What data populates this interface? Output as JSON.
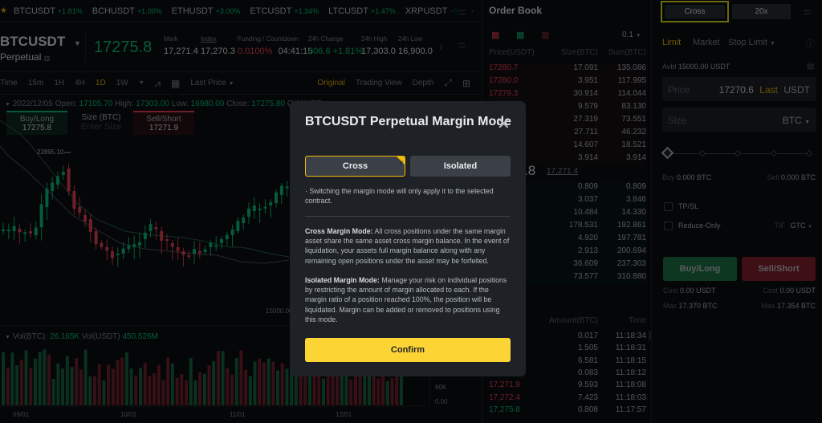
{
  "ticker": {
    "items": [
      {
        "symbol": "BTCUSDT",
        "change": "+1.81%"
      },
      {
        "symbol": "BCHUSDT",
        "change": "+1.00%"
      },
      {
        "symbol": "ETHUSDT",
        "change": "+3.00%"
      },
      {
        "symbol": "ETCUSDT",
        "change": "+1.34%"
      },
      {
        "symbol": "LTCUSDT",
        "change": "+1.47%"
      },
      {
        "symbol": "XRPUSDT",
        "change": "+0"
      }
    ]
  },
  "symbol": {
    "name": "BTCUSDT",
    "type": "Perpetual",
    "last_price": "17275.8",
    "stats": [
      {
        "label": "Mark",
        "value": "17,271.4"
      },
      {
        "label": "Index",
        "value": "17,270.3"
      },
      {
        "label": "Funding / Countdown",
        "value": "0.0100%",
        "value2": "04:41:15"
      },
      {
        "label": "24h Change",
        "value": "306.6 +1.81%"
      },
      {
        "label": "24h High",
        "value": "17,303.0"
      },
      {
        "label": "24h Low",
        "value": "16,900.0"
      }
    ]
  },
  "chart_toolbar": {
    "intervals": [
      "Time",
      "15m",
      "1H",
      "4H",
      "1D",
      "1W"
    ],
    "active_interval": "1D",
    "price_type": "Last Price",
    "views": [
      "Original",
      "Trading View",
      "Depth"
    ],
    "active_view": "Original"
  },
  "chart": {
    "ohlc_date": "2022/12/05",
    "open_label": "Open:",
    "open": "17105.70",
    "high_label": "High:",
    "high": "17303.00",
    "low_label": "Low:",
    "low": "16980.00",
    "close_label": "Close:",
    "close": "17275.80",
    "change_label": "CHANGE",
    "quick_buy_label": "Buy/Long",
    "quick_buy_price": "17275.8",
    "quick_size_label": "Size (BTC)",
    "quick_size_placeholder": "Enter Size",
    "quick_sell_label": "Sell/Short",
    "quick_sell_price": "17271.9",
    "high_marker": "22895.10",
    "price_axis_label": "15000.00",
    "vol_btc_label": "Vol(BTC):",
    "vol_btc": "26.165K",
    "vol_usdt_label": "Vol(USDT)",
    "vol_usdt": "450.526M",
    "vol_axis": [
      "60K",
      "0.00"
    ],
    "date_ticks": [
      "09/01",
      "10/01",
      "11/01",
      "12/01"
    ]
  },
  "orderbook": {
    "title": "Order Book",
    "precision": "0.1",
    "headers": [
      "Price(USDT)",
      "Size(BTC)",
      "Sum(BTC)"
    ],
    "asks": [
      {
        "price": "17280.7",
        "size": "17.091",
        "sum": "135.086"
      },
      {
        "price": "17280.0",
        "size": "3.951",
        "sum": "117.995"
      },
      {
        "price": "17279.3",
        "size": "30.914",
        "sum": "114.044"
      },
      {
        "price": "",
        "size": "9.579",
        "sum": "83.130"
      },
      {
        "price": "",
        "size": "27.319",
        "sum": "73.551"
      },
      {
        "price": "",
        "size": "27.711",
        "sum": "46.232"
      },
      {
        "price": "",
        "size": "14.607",
        "sum": "18.521"
      },
      {
        "price": "",
        "size": "3.914",
        "sum": "3.914"
      }
    ],
    "mid_price": ".8",
    "mark_price": "17,271.4",
    "bids": [
      {
        "price": "",
        "size": "0.809",
        "sum": "0.809"
      },
      {
        "price": "",
        "size": "3.037",
        "sum": "3.846"
      },
      {
        "price": "",
        "size": "10.484",
        "sum": "14.330"
      },
      {
        "price": "",
        "size": "178.531",
        "sum": "192.861"
      },
      {
        "price": "",
        "size": "4.920",
        "sum": "197.781"
      },
      {
        "price": "",
        "size": "2.913",
        "sum": "200.694"
      },
      {
        "price": "",
        "size": "36.609",
        "sum": "237.303"
      },
      {
        "price": "",
        "size": "73.577",
        "sum": "310.880"
      }
    ]
  },
  "trades": {
    "headers": [
      "Amount(BTC)",
      "Time"
    ],
    "rows": [
      {
        "price": "",
        "side": "",
        "amount": "0.017",
        "time": "11:18:34"
      },
      {
        "price": "",
        "side": "",
        "amount": "1.505",
        "time": "11:18:31"
      },
      {
        "price": "",
        "side": "",
        "amount": "6.581",
        "time": "11:18:15"
      },
      {
        "price": "",
        "side": "",
        "amount": "0.083",
        "time": "11:18:12"
      },
      {
        "price": "17,271.9",
        "side": "sell",
        "amount": "9.593",
        "time": "11:18:08"
      },
      {
        "price": "17,272.4",
        "side": "sell",
        "amount": "7.423",
        "time": "11:18:03"
      },
      {
        "price": "17,275.8",
        "side": "buy",
        "amount": "0.808",
        "time": "11:17:57"
      }
    ]
  },
  "order_panel": {
    "margin_mode": "Cross",
    "leverage": "20x",
    "order_types": [
      "Limit",
      "Market",
      "Stop Limit"
    ],
    "active_order_type": "Limit",
    "avbl_label": "Avbl",
    "avbl": "15000.00 USDT",
    "price_label": "Price",
    "price_value": "17270.6",
    "price_last": "Last",
    "price_unit": "USDT",
    "size_label": "Size",
    "size_unit": "BTC",
    "slider_percent": 0,
    "buy_amount_label": "Buy",
    "buy_amount": "0.000 BTC",
    "sell_amount_label": "Sell",
    "sell_amount": "0.000 BTC",
    "tpsl_label": "TP/SL",
    "reduce_only_label": "Reduce-Only",
    "tif_label": "TIF",
    "tif_value": "GTC",
    "buy_button": "Buy/Long",
    "sell_button": "Sell/Short",
    "cost_label": "Cost",
    "buy_cost": "0.00 USDT",
    "sell_cost": "0.00 USDT",
    "max_label": "Max",
    "buy_max": "17.370 BTC",
    "sell_max": "17.354 BTC"
  },
  "modal": {
    "title": "BTCUSDT Perpetual Margin Mode",
    "options": [
      "Cross",
      "Isolated"
    ],
    "selected": "Cross",
    "note": "· Switching the margin mode will only apply it to the selected contract.",
    "cross_title": "Cross Margin Mode:",
    "cross_text": " All cross positions under the same margin asset share the same asset cross margin balance. In the event of liquidation, your assets full margin balance along with any remaining open positions under the asset may be forfeited.",
    "isolated_title": "Isolated Margin Mode:",
    "isolated_text": " Manage your risk on individual positions by restricting the amount of margin allocated to each. If the margin ratio of a position reached 100%, the position will be liquidated. Margin can be added or removed to positions using this mode.",
    "confirm": "Confirm"
  },
  "colors": {
    "up": "#0ecb81",
    "down": "#f6465d",
    "accent": "#f0b90b",
    "confirm": "#fcd535"
  }
}
